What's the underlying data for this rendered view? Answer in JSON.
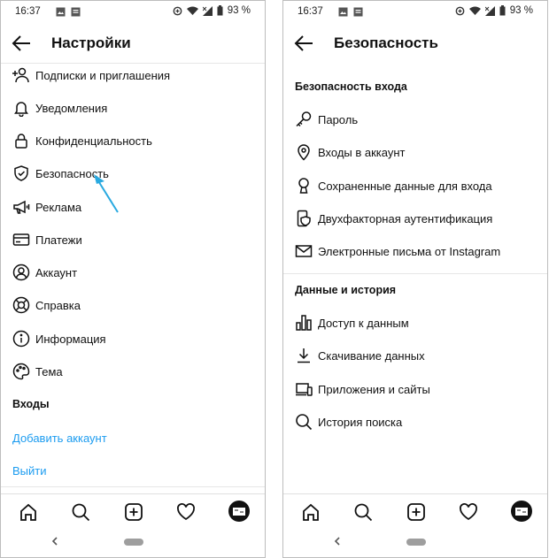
{
  "status_bar": {
    "time": "16:37",
    "battery": "93 %"
  },
  "left": {
    "title": "Настройки",
    "items": [
      {
        "label": "Подписки и приглашения",
        "icon": "add-person-icon"
      },
      {
        "label": "Уведомления",
        "icon": "bell-icon"
      },
      {
        "label": "Конфиденциальность",
        "icon": "lock-icon"
      },
      {
        "label": "Безопасность",
        "icon": "shield-icon"
      },
      {
        "label": "Реклама",
        "icon": "megaphone-icon"
      },
      {
        "label": "Платежи",
        "icon": "card-icon"
      },
      {
        "label": "Аккаунт",
        "icon": "account-icon"
      },
      {
        "label": "Справка",
        "icon": "lifebuoy-icon"
      },
      {
        "label": "Информация",
        "icon": "info-icon"
      },
      {
        "label": "Тема",
        "icon": "palette-icon"
      }
    ],
    "logins_section": "Входы",
    "add_account": "Добавить аккаунт",
    "logout": "Выйти"
  },
  "right": {
    "title": "Безопасность",
    "login_security": {
      "heading": "Безопасность входа",
      "items": [
        {
          "label": "Пароль",
          "icon": "key-icon"
        },
        {
          "label": "Входы в аккаунт",
          "icon": "location-pin-icon"
        },
        {
          "label": "Сохраненные данные для входа",
          "icon": "keyhole-icon"
        },
        {
          "label": "Двухфакторная аутентификация",
          "icon": "phone-shield-icon"
        },
        {
          "label": "Электронные письма от Instagram",
          "icon": "envelope-icon"
        }
      ]
    },
    "data_history": {
      "heading": "Данные и история",
      "items": [
        {
          "label": "Доступ к данным",
          "icon": "bar-chart-icon"
        },
        {
          "label": "Скачивание данных",
          "icon": "download-icon"
        },
        {
          "label": "Приложения и сайты",
          "icon": "devices-icon"
        },
        {
          "label": "История поиска",
          "icon": "search-icon"
        }
      ]
    }
  },
  "bottom_nav": [
    "home-icon",
    "search-icon",
    "new-post-icon",
    "activity-heart-icon",
    "profile-avatar-icon"
  ],
  "colors": {
    "link": "#1c9cf0",
    "annotation_arrow": "#29a9e0",
    "divider": "#e6e6e6"
  }
}
